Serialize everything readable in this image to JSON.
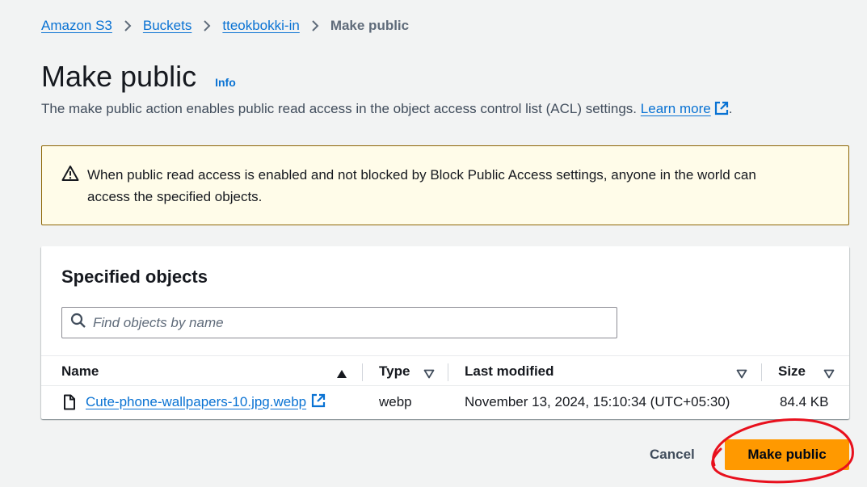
{
  "breadcrumb": {
    "items": [
      "Amazon S3",
      "Buckets",
      "tteokbokki-in"
    ],
    "current": "Make public"
  },
  "header": {
    "title": "Make public",
    "info_label": "Info",
    "description": "The make public action enables public read access in the object access control list (ACL) settings.",
    "learn_more_label": "Learn more",
    "description_end": "."
  },
  "alert": {
    "icon": "warning-icon",
    "text": "When public read access is enabled and not blocked by Block Public Access settings, anyone in the world can access the specified objects."
  },
  "objects_panel": {
    "title": "Specified objects",
    "search_placeholder": "Find objects by name",
    "columns": [
      "Name",
      "Type",
      "Last modified",
      "Size"
    ],
    "rows": [
      {
        "name": "Cute-phone-wallpapers-10.jpg.webp",
        "type": "webp",
        "last_modified": "November 13, 2024, 15:10:34 (UTC+05:30)",
        "size": "84.4 KB"
      }
    ]
  },
  "footer": {
    "cancel_label": "Cancel",
    "submit_label": "Make public"
  },
  "colors": {
    "link": "#0972d3",
    "primary_button": "#ff9900",
    "alert_background": "#fffce9",
    "alert_border": "#8d6605",
    "annotation": "#e8101d"
  }
}
